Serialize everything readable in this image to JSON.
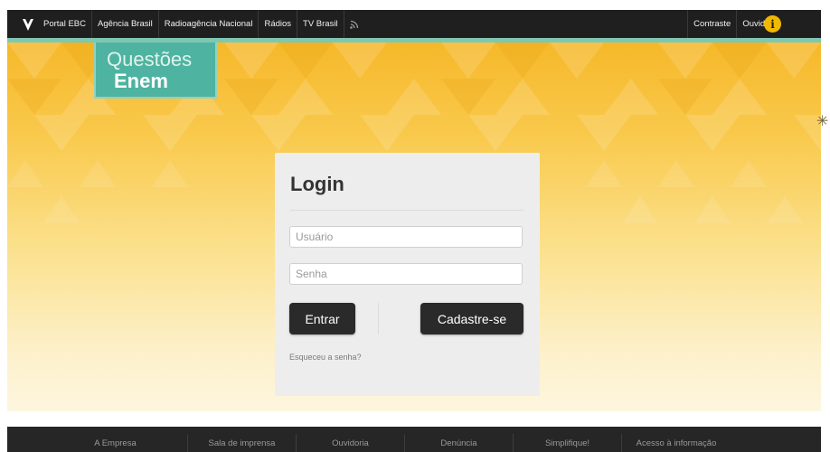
{
  "topbar": {
    "logo_icon": "ebc-logo-icon",
    "nav": [
      "Portal EBC",
      "Agência Brasil",
      "Radioagência Nacional",
      "Rádios",
      "TV Brasil"
    ],
    "rss_icon": "rss-icon",
    "right": [
      "Contraste",
      "Ouvidoria"
    ],
    "info_icon": "info-icon",
    "info_glyph": "i",
    "accent": "#7ec7b2"
  },
  "brand": {
    "line1": "Questões",
    "line2": "Enem",
    "color": "#4fb3a1"
  },
  "banner": {
    "colors": [
      "#f6b82a",
      "#fdf6df"
    ]
  },
  "login": {
    "title": "Login",
    "username_placeholder": "Usuário",
    "password_placeholder": "Senha",
    "submit_label": "Entrar",
    "register_label": "Cadastre-se",
    "forgot_label": "Esqueceu a senha?"
  },
  "footer": {
    "items": [
      "A Empresa",
      "Sala de imprensa",
      "Ouvidoria",
      "Denúncia",
      "Simplifique!",
      "Acesso à informação"
    ]
  }
}
